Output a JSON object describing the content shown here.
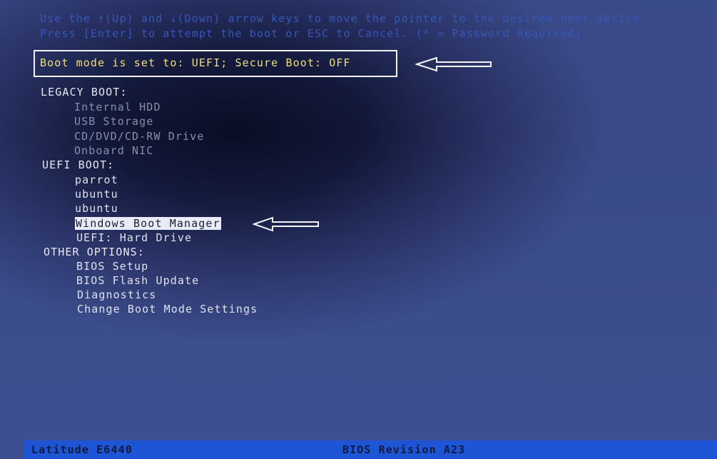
{
  "instructions": {
    "line1": "Use the ↑(Up) and ↓(Down) arrow keys to move the pointer to the desired boot device",
    "line2": "Press [Enter] to attempt the boot or ESC to Cancel. (* = Password Required)"
  },
  "boot_mode": {
    "text": "Boot mode is set to: UEFI; Secure Boot: OFF"
  },
  "legacy_boot": {
    "heading": "LEGACY BOOT:",
    "items": [
      {
        "label": "Internal HDD"
      },
      {
        "label": "USB Storage"
      },
      {
        "label": "CD/DVD/CD-RW Drive"
      },
      {
        "label": "Onboard NIC"
      }
    ]
  },
  "uefi_boot": {
    "heading": "UEFI BOOT:",
    "items": [
      {
        "label": "parrot"
      },
      {
        "label": "ubuntu"
      },
      {
        "label": "ubuntu"
      },
      {
        "label": "Windows Boot Manager",
        "selected": true
      },
      {
        "label": "UEFI: Hard Drive"
      }
    ]
  },
  "other_options": {
    "heading": "OTHER OPTIONS:",
    "items": [
      {
        "label": "BIOS Setup"
      },
      {
        "label": "BIOS Flash Update"
      },
      {
        "label": "Diagnostics"
      },
      {
        "label": "Change Boot Mode Settings"
      }
    ]
  },
  "status_bar": {
    "model": "Latitude E6440",
    "bios_revision": "BIOS Revision A23"
  },
  "colors": {
    "instruction_text": "#3856b8",
    "boot_mode_text": "#f0df7a",
    "status_bar": "#1e54d6",
    "selection_highlight": "#e9ecf6"
  },
  "icons": {
    "boot_mode_arrow": "left-arrow-icon",
    "selection_arrow": "left-arrow-icon"
  }
}
